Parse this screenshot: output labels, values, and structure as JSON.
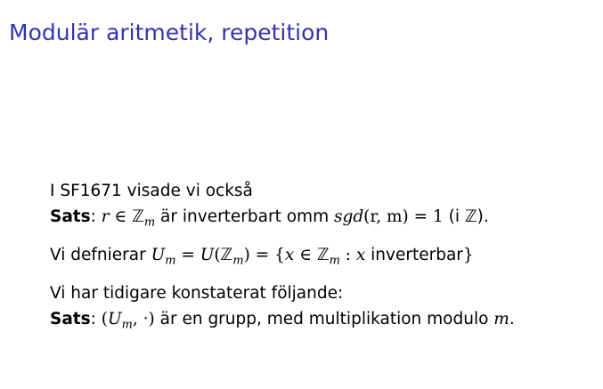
{
  "slide": {
    "title": "Modulär aritmetik, repetition"
  },
  "para1": {
    "line1": "I SF1671 visade vi också",
    "label": "Sats",
    "r": "r",
    "in": " ∈ ",
    "Z": "ℤ",
    "m": "m",
    "text1": " är inverterbart omm ",
    "sgd": "sgd",
    "args": "(r, m) = 1",
    "text2": " (i ",
    "Z2": "ℤ",
    "text3": ")."
  },
  "para2": {
    "text1": "Vi defnierar ",
    "U": "U",
    "m": "m",
    "eq1": " = ",
    "U2": "U",
    "lp": "(",
    "Z": "ℤ",
    "m2": "m",
    "rp": ")",
    "eq2": " = {",
    "x": "x",
    "in": " ∈ ",
    "Z2": "ℤ",
    "m3": "m",
    "colon": " : ",
    "x2": "x",
    "text2": " inverterbar",
    "close": "}"
  },
  "para3": {
    "line1": "Vi har tidigare konstaterat följande:",
    "label": "Sats",
    "lp": " (",
    "U": "U",
    "m": "m",
    "dot": ", ·)",
    "text": " är en grupp, med multiplikation modulo ",
    "mod": "m",
    "end": "."
  }
}
